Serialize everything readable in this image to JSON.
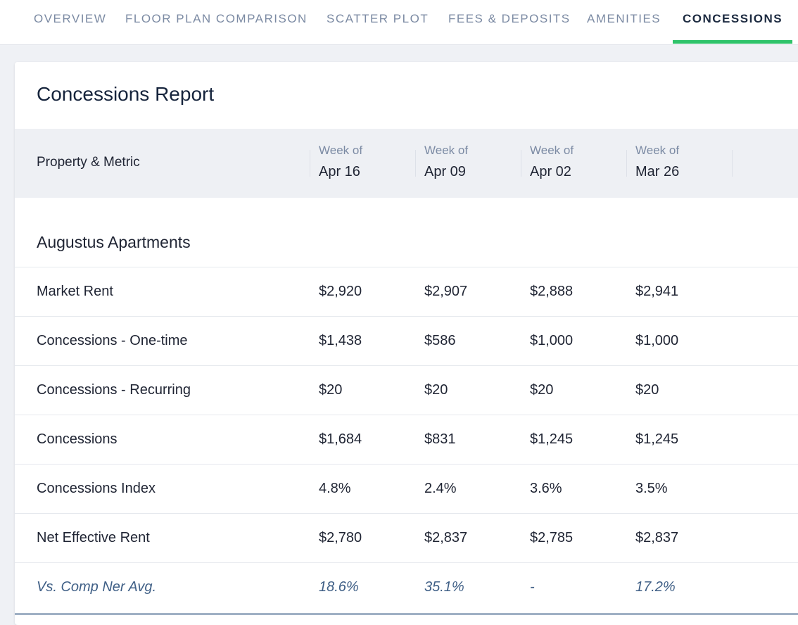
{
  "tabs": [
    {
      "label": "OVERVIEW",
      "active": false
    },
    {
      "label": "FLOOR PLAN COMPARISON",
      "active": false
    },
    {
      "label": "SCATTER PLOT",
      "active": false
    },
    {
      "label": "FEES & DEPOSITS",
      "active": false
    },
    {
      "label": "AMENITIES",
      "active": false
    },
    {
      "label": "CONCESSIONS",
      "active": true
    }
  ],
  "accent_color": "#2fc36a",
  "report": {
    "title": "Concessions Report",
    "header": {
      "metric_label": "Property & Metric",
      "week_prefix": "Week of",
      "weeks": [
        "Apr 16",
        "Apr 09",
        "Apr 02",
        "Mar 26"
      ]
    },
    "property": {
      "name": "Augustus Apartments",
      "rows": [
        {
          "metric": "Market Rent",
          "values": [
            "$2,920",
            "$2,907",
            "$2,888",
            "$2,941"
          ]
        },
        {
          "metric": "Concessions - One-time",
          "values": [
            "$1,438",
            "$586",
            "$1,000",
            "$1,000"
          ]
        },
        {
          "metric": "Concessions - Recurring",
          "values": [
            "$20",
            "$20",
            "$20",
            "$20"
          ]
        },
        {
          "metric": "Concessions",
          "values": [
            "$1,684",
            "$831",
            "$1,245",
            "$1,245"
          ]
        },
        {
          "metric": "Concessions Index",
          "values": [
            "4.8%",
            "2.4%",
            "3.6%",
            "3.5%"
          ]
        },
        {
          "metric": "Net Effective Rent",
          "values": [
            "$2,780",
            "$2,837",
            "$2,785",
            "$2,837"
          ]
        },
        {
          "metric": "Vs. Comp Ner Avg.",
          "values": [
            "18.6%",
            "35.1%",
            "-",
            "17.2%"
          ],
          "italic": true
        }
      ]
    }
  }
}
